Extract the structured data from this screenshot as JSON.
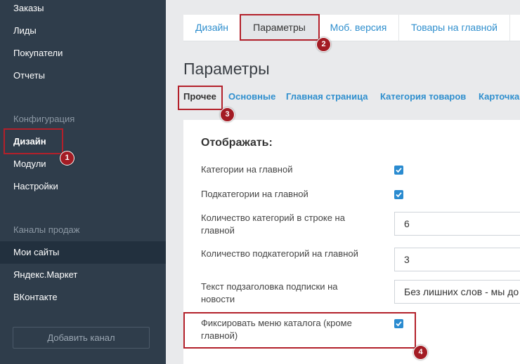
{
  "sidebar": {
    "top_items": [
      {
        "label": "Заказы"
      },
      {
        "label": "Лиды"
      },
      {
        "label": "Покупатели"
      },
      {
        "label": "Отчеты"
      }
    ],
    "config_section": "Конфигурация",
    "config_items": [
      {
        "label": "Дизайн"
      },
      {
        "label": "Модули"
      },
      {
        "label": "Настройки"
      }
    ],
    "channels_section": "Каналы продаж",
    "channel_items": [
      {
        "label": "Мои сайты"
      },
      {
        "label": "Яндекс.Маркет"
      },
      {
        "label": "ВКонтакте"
      }
    ],
    "add_channel": "Добавить канал"
  },
  "tabs": [
    {
      "label": "Дизайн"
    },
    {
      "label": "Параметры"
    },
    {
      "label": "Моб. версия"
    },
    {
      "label": "Товары на главной"
    }
  ],
  "page_title": "Параметры",
  "subtabs": [
    {
      "label": "Прочее"
    },
    {
      "label": "Основные"
    },
    {
      "label": "Главная страница"
    },
    {
      "label": "Категория товаров"
    },
    {
      "label": "Карточка"
    }
  ],
  "panel": {
    "heading": "Отображать:",
    "rows": [
      {
        "label": "Категории на главной",
        "checked": true
      },
      {
        "label": "Подкатегории на главной",
        "checked": true
      },
      {
        "label": "Количество категорий в строке на главной",
        "value": "6"
      },
      {
        "label": "Количество подкатегорий на главной",
        "value": "3"
      },
      {
        "label": "Текст подзаголовка подписки на новости",
        "value": "Без лишних слов - мы до"
      },
      {
        "label": "Фиксировать меню каталога (кроме главной)",
        "checked": true
      }
    ]
  },
  "annotations": [
    "1",
    "2",
    "3",
    "4"
  ],
  "colors": {
    "sidebar_bg": "#2f3d4b",
    "link": "#2f8fce",
    "checkbox": "#2a8bd0",
    "highlight": "#b3202a"
  }
}
